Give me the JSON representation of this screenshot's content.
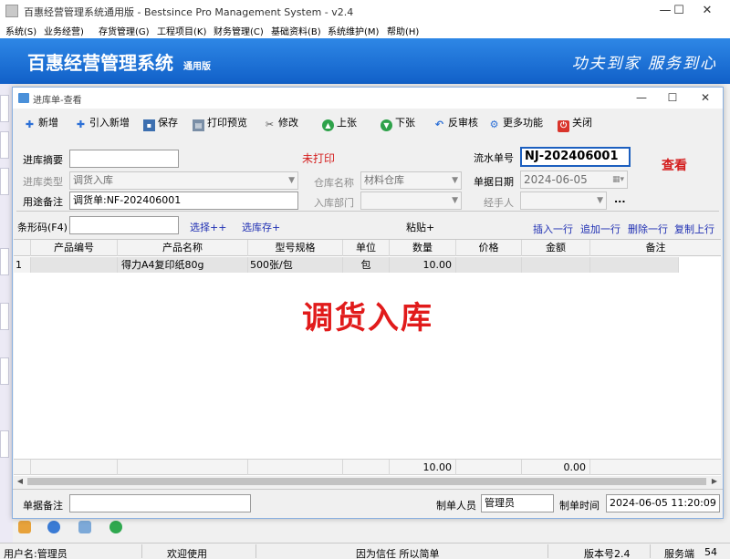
{
  "window": {
    "title": "百惠经营管理系统通用版 - Bestsince Pro Management System - v2.4",
    "minimize": "—",
    "maximize": "☐",
    "close": "✕"
  },
  "menu": [
    "系统(S)",
    "业务经营)",
    "存货管理(G)",
    "工程项目(K)",
    "财务管理(C)",
    "基础资料(B)",
    "系统维护(M)",
    "帮助(H)"
  ],
  "banner": {
    "title": "百惠经营管理系统",
    "edition": "通用版",
    "slogan": "功夫到家  服务到心"
  },
  "dialog": {
    "title": "进库单-查看",
    "toolbar": {
      "new": "新增",
      "import_new": "引入新增",
      "save": "保存",
      "print_preview": "打印预览",
      "edit": "修改",
      "prev": "上张",
      "next": "下张",
      "unapprove": "反审核",
      "more": "更多功能",
      "close": "关闭"
    },
    "form": {
      "summary_label": "进库摘要",
      "summary_value": "",
      "type_label": "进库类型",
      "type_value": "调货入库",
      "purpose_label": "用途备注",
      "purpose_value": "调货单:NF-202406001",
      "print_status": "未打印",
      "warehouse_label": "仓库名称",
      "warehouse_value": "材料仓库",
      "dept_label": "入库部门",
      "dept_value": "",
      "serial_label": "流水单号",
      "serial_value": "NJ-202406001",
      "date_label": "单据日期",
      "date_value": "2024-06-05",
      "handler_label": "经手人",
      "handler_value": "",
      "handler_more": "...",
      "mode": "查看"
    },
    "barcode": {
      "label": "条形码(F4)",
      "value": "",
      "select": "选择++",
      "select_stock": "选库存+",
      "paste": "粘贴+",
      "insert_row": "插入一行",
      "append_row": "追加一行",
      "delete_row": "删除一行",
      "copy_prev": "复制上行"
    },
    "grid": {
      "columns": [
        "产品编号",
        "产品名称",
        "型号规格",
        "单位",
        "数量",
        "价格",
        "金额",
        "备注"
      ],
      "rows": [
        {
          "no": "1",
          "code": "",
          "name": "得力A4复印纸80g",
          "spec": "500张/包",
          "unit": "包",
          "qty": "10.00",
          "price": "",
          "amount": "",
          "remark": ""
        }
      ],
      "watermark": "调货入库",
      "totals": {
        "qty": "10.00",
        "amount": "0.00"
      }
    },
    "footer": {
      "remark_label": "单据备注",
      "remark_value": "",
      "creator_label": "制单人员",
      "creator_value": "管理员",
      "time_label": "制单时间",
      "time_value": "2024-06-05 11:20:09"
    }
  },
  "statusbar": {
    "user": "用户名:管理员",
    "welcome": "欢迎使用",
    "motto": "因为信任 所以简单",
    "version": "版本号2.4",
    "server": "服务端",
    "server_no": "54"
  }
}
